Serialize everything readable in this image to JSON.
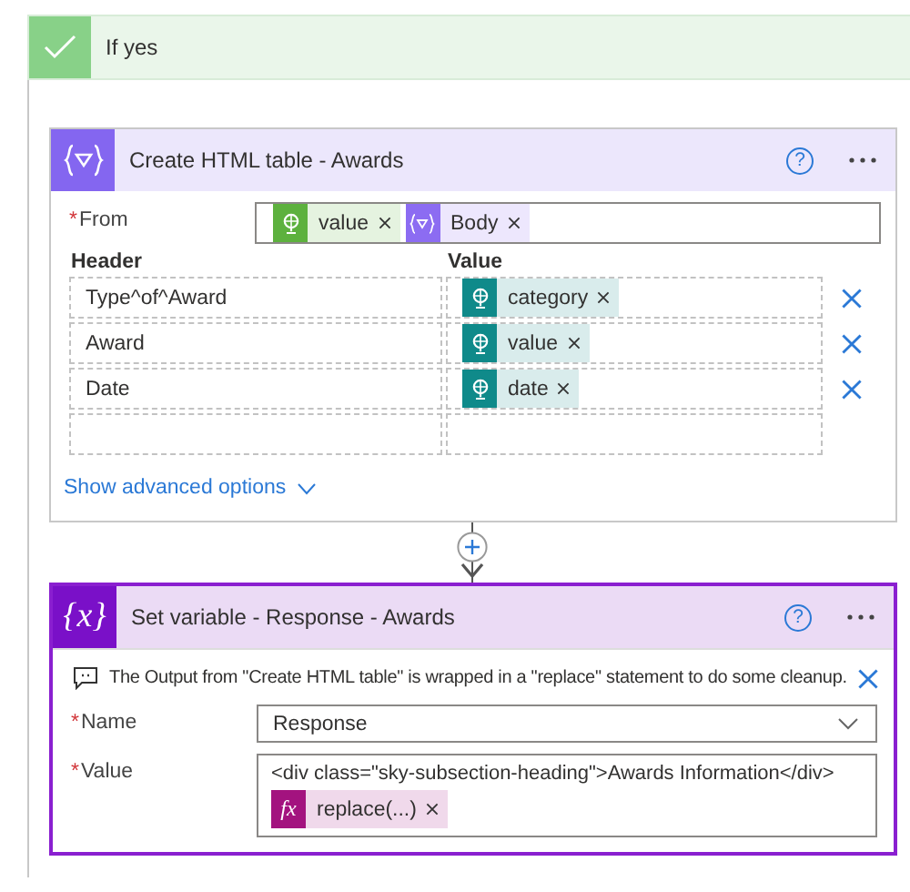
{
  "scope": {
    "title": "If yes"
  },
  "cards": [
    {
      "kind": "table",
      "title": "Create HTML table - Awards",
      "help": "?",
      "selected": false,
      "from": {
        "label": "From",
        "required_mark": "*",
        "tokens": [
          {
            "kind": "dynamic",
            "label": "value",
            "color": "#5db13e"
          },
          {
            "kind": "expression",
            "label": "Body",
            "color": "#8c6cf2"
          }
        ]
      },
      "columns": [
        "Header",
        "Value"
      ],
      "rows": [
        {
          "kind": "entry",
          "header": "Type^of^Award",
          "tokens": [
            {
              "kind": "dynamic",
              "label": "category",
              "color": "#0f8a8a"
            }
          ]
        },
        {
          "kind": "entry",
          "header": "Award",
          "tokens": [
            {
              "kind": "dynamic",
              "label": "value",
              "color": "#0f8a8a"
            }
          ]
        },
        {
          "kind": "entry",
          "header": "Date",
          "tokens": [
            {
              "kind": "dynamic",
              "label": "date",
              "color": "#0f8a8a"
            }
          ]
        },
        {
          "kind": "blank"
        }
      ],
      "advanced": {
        "label": "Show advanced options",
        "expanded": false
      }
    },
    {
      "kind": "variable",
      "title": "Set variable - Response - Awards",
      "icon_text": "{x}",
      "help": "?",
      "selected": true,
      "notice": "The Output from \"Create HTML table\" is wrapped in a \"replace\" statement to do some cleanup.",
      "fields": [
        {
          "kind": "dropdown",
          "label": "Name",
          "required_mark": "*",
          "value": "Response"
        },
        {
          "kind": "text",
          "label": "Value",
          "required_mark": "*",
          "value": "<div class=\"sky-subsection-heading\">Awards Information</div>",
          "tokens": [
            {
              "kind": "function",
              "icon_text": "fx",
              "label": "replace(...)",
              "color": "#a3137f"
            }
          ]
        }
      ]
    }
  ]
}
